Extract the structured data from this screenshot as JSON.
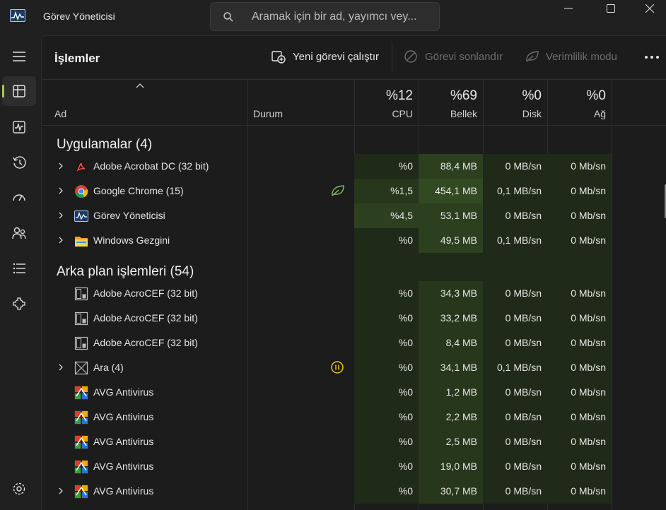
{
  "window": {
    "title": "Görev Yöneticisi",
    "search_placeholder": "Aramak için bir ad, yayımcı vey..."
  },
  "nav": {
    "items": [
      {
        "icon": "processes-icon",
        "active": true
      },
      {
        "icon": "performance-icon",
        "active": false
      },
      {
        "icon": "app-history-icon",
        "active": false
      },
      {
        "icon": "startup-apps-icon",
        "active": false
      },
      {
        "icon": "users-icon",
        "active": false
      },
      {
        "icon": "details-icon",
        "active": false
      },
      {
        "icon": "services-icon",
        "active": false
      }
    ],
    "settings_icon": "settings-icon"
  },
  "toolbar": {
    "page_title": "İşlemler",
    "run_new_task": "Yeni görevi çalıştır",
    "end_task": "Görevi sonlandır",
    "efficiency_mode": "Verimlilik modu"
  },
  "columns": {
    "name": "Ad",
    "status": "Durum",
    "cpu_pct": "%12",
    "cpu": "CPU",
    "mem_pct": "%69",
    "mem": "Bellek",
    "disk_pct": "%0",
    "disk": "Disk",
    "net_pct": "%0",
    "net": "Ağ"
  },
  "groups": {
    "apps": "Uygulamalar (4)",
    "background": "Arka plan işlemleri (54)"
  },
  "apps": [
    {
      "name": "Adobe Acrobat DC (32 bit)",
      "icon": "acrobat-icon",
      "expand": true,
      "status": "",
      "cpu": "%0",
      "mem": "88,4 MB",
      "disk": "0 MB/sn",
      "net": "0 Mb/sn",
      "cpu_level": 0,
      "mem_level": 2
    },
    {
      "name": "Google Chrome (15)",
      "icon": "chrome-icon",
      "expand": true,
      "status": "efficiency-leaf-icon",
      "cpu": "%1,5",
      "mem": "454,1 MB",
      "disk": "0,1 MB/sn",
      "net": "0 Mb/sn",
      "cpu_level": 1,
      "mem_level": 3
    },
    {
      "name": "Görev Yöneticisi",
      "icon": "task-manager-icon",
      "expand": true,
      "status": "",
      "cpu": "%4,5",
      "mem": "53,1 MB",
      "disk": "0 MB/sn",
      "net": "0 Mb/sn",
      "cpu_level": 2,
      "mem_level": 2
    },
    {
      "name": "Windows Gezgini",
      "icon": "explorer-folder-icon",
      "expand": true,
      "status": "",
      "cpu": "%0",
      "mem": "49,5 MB",
      "disk": "0,1 MB/sn",
      "net": "0 Mb/sn",
      "cpu_level": 0,
      "mem_level": 2
    }
  ],
  "background": [
    {
      "name": "Adobe AcroCEF (32 bit)",
      "icon": "generic-process-icon",
      "expand": false,
      "status": "",
      "cpu": "%0",
      "mem": "34,3 MB",
      "disk": "0 MB/sn",
      "net": "0 Mb/sn"
    },
    {
      "name": "Adobe AcroCEF (32 bit)",
      "icon": "generic-process-icon",
      "expand": false,
      "status": "",
      "cpu": "%0",
      "mem": "33,2 MB",
      "disk": "0 MB/sn",
      "net": "0 Mb/sn"
    },
    {
      "name": "Adobe AcroCEF (32 bit)",
      "icon": "generic-process-icon",
      "expand": false,
      "status": "",
      "cpu": "%0",
      "mem": "8,4 MB",
      "disk": "0 MB/sn",
      "net": "0 Mb/sn"
    },
    {
      "name": "Ara (4)",
      "icon": "search-process-icon",
      "expand": true,
      "status": "suspended-icon",
      "cpu": "%0",
      "mem": "34,1 MB",
      "disk": "0,1 MB/sn",
      "net": "0 Mb/sn"
    },
    {
      "name": "AVG Antivirus",
      "icon": "avg-icon",
      "expand": false,
      "status": "",
      "cpu": "%0",
      "mem": "1,2 MB",
      "disk": "0 MB/sn",
      "net": "0 Mb/sn"
    },
    {
      "name": "AVG Antivirus",
      "icon": "avg-icon",
      "expand": false,
      "status": "",
      "cpu": "%0",
      "mem": "2,2 MB",
      "disk": "0 MB/sn",
      "net": "0 Mb/sn"
    },
    {
      "name": "AVG Antivirus",
      "icon": "avg-icon",
      "expand": false,
      "status": "",
      "cpu": "%0",
      "mem": "2,5 MB",
      "disk": "0 MB/sn",
      "net": "0 Mb/sn"
    },
    {
      "name": "AVG Antivirus",
      "icon": "avg-icon",
      "expand": false,
      "status": "",
      "cpu": "%0",
      "mem": "19,0 MB",
      "disk": "0 MB/sn",
      "net": "0 Mb/sn"
    },
    {
      "name": "AVG Antivirus",
      "icon": "avg-icon",
      "expand": true,
      "status": "",
      "cpu": "%0",
      "mem": "30,7 MB",
      "disk": "0 MB/sn",
      "net": "0 Mb/sn"
    }
  ],
  "colors": {
    "heat0": "#1f2a18",
    "heat1": "#26371b",
    "heat2": "#2c4020",
    "heat3": "#324a22",
    "accent": "#9ed04b"
  }
}
